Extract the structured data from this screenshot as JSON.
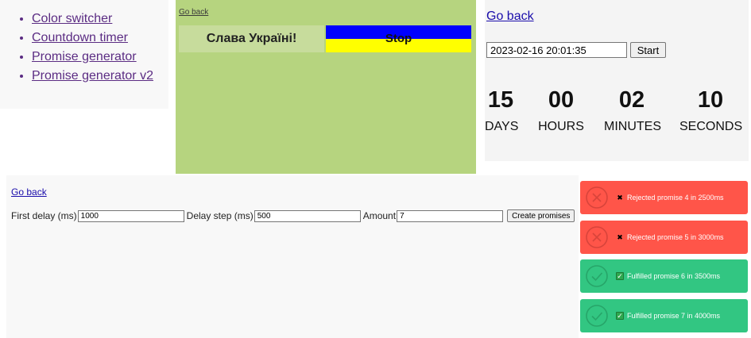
{
  "nav": {
    "items": [
      {
        "label": "Color switcher"
      },
      {
        "label": "Countdown timer"
      },
      {
        "label": "Promise generator"
      },
      {
        "label": "Promise generator v2"
      }
    ]
  },
  "color_switcher": {
    "go_back": "Go back",
    "start_label": "Слава Україні!",
    "stop_label": "Stop",
    "background_color": "#b6d47f",
    "stop_colors": [
      "#0000ff",
      "#ffff00"
    ]
  },
  "timer": {
    "go_back": "Go back",
    "date_value": "2023-02-16 20:01:35",
    "start_label": "Start",
    "fields": [
      {
        "value": "15",
        "label": "DAYS"
      },
      {
        "value": "00",
        "label": "HOURS"
      },
      {
        "value": "02",
        "label": "MINUTES"
      },
      {
        "value": "10",
        "label": "SECONDS"
      }
    ]
  },
  "promise_generator": {
    "go_back": "Go back",
    "first_delay_label": "First delay (ms)",
    "first_delay_value": "1000",
    "delay_step_label": "Delay step (ms)",
    "delay_step_value": "500",
    "amount_label": "Amount",
    "amount_value": "7",
    "create_label": "Create promises"
  },
  "toasts": [
    {
      "status": "rejected",
      "icon": "cross-mark-icon",
      "text": "Rejected promise 4 in 2500ms"
    },
    {
      "status": "rejected",
      "icon": "cross-mark-icon",
      "text": "Rejected promise 5 in 3000ms"
    },
    {
      "status": "fulfilled",
      "icon": "check-box-icon",
      "text": "Fulfilled promise 6 in 3500ms"
    },
    {
      "status": "fulfilled",
      "icon": "check-box-icon",
      "text": "Fulfilled promise 7 in 4000ms"
    }
  ],
  "colors": {
    "rejected": "#ff5549",
    "fulfilled": "#32c682",
    "link": "#1a0dab",
    "visited_link": "#5b2c83"
  }
}
